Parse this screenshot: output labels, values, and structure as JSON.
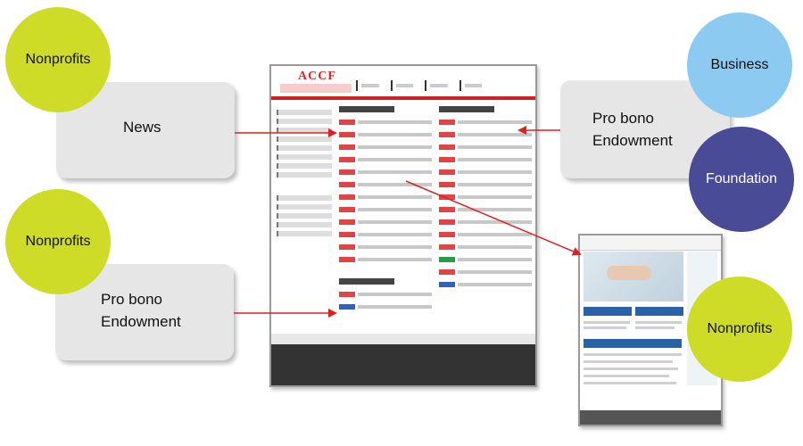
{
  "boxes": {
    "news": "News",
    "probono_left_line1": "Pro bono",
    "probono_left_line2": "Endowment",
    "probono_right_line1": "Pro bono",
    "probono_right_line2": "Endowment"
  },
  "circles": {
    "nonprofits_top": "Nonprofits",
    "nonprofits_mid": "Nonprofits",
    "nonprofits_right": "Nonprofits",
    "business": "Business",
    "foundation": "Foundation"
  },
  "site": {
    "logo": "ACCF"
  },
  "colors": {
    "green": "#cfdc27",
    "blue": "#8ccaf2",
    "purple": "#4a4b97",
    "arrow": "#e02020",
    "box": "#e6e6e6"
  }
}
